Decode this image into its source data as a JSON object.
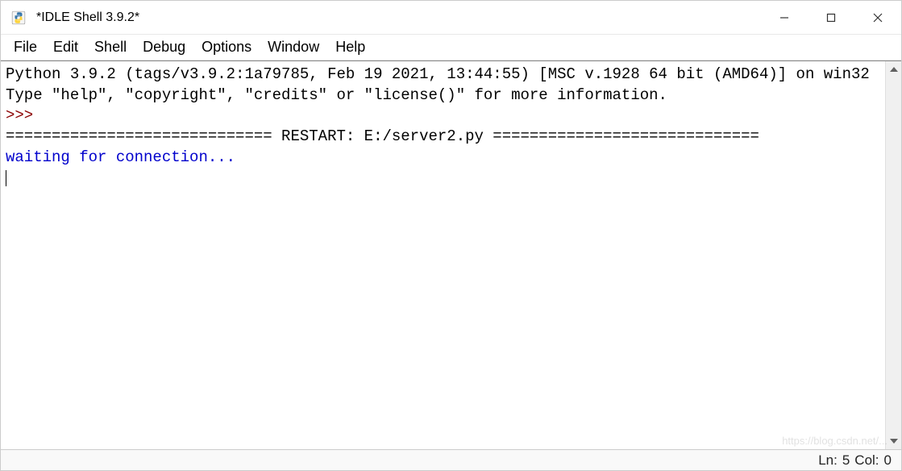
{
  "window": {
    "title": "*IDLE Shell 3.9.2*"
  },
  "menu": {
    "items": [
      "File",
      "Edit",
      "Shell",
      "Debug",
      "Options",
      "Window",
      "Help"
    ]
  },
  "shell": {
    "banner_line1": "Python 3.9.2 (tags/v3.9.2:1a79785, Feb 19 2021, 13:44:55) [MSC v.1928 64 bit (AMD64)] on win32",
    "banner_line2": "Type \"help\", \"copyright\", \"credits\" or \"license()\" for more information.",
    "prompt": ">>> ",
    "restart_line": "============================= RESTART: E:/server2.py =============================",
    "output_line": "waiting for connection..."
  },
  "status": {
    "line_label": "Ln:",
    "line_value": "5",
    "col_label": "Col:",
    "col_value": "0"
  },
  "watermark": "https://blog.csdn.net/..."
}
